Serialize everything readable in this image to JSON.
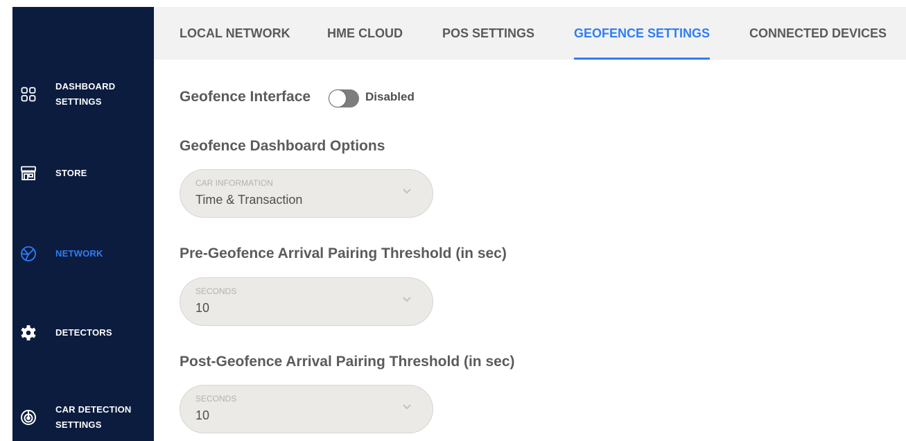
{
  "sidebar": {
    "items": [
      {
        "icon": "dashboard-grid-icon",
        "label": "DASHBOARD\nSETTINGS",
        "active": false
      },
      {
        "icon": "store-icon",
        "label": "STORE",
        "active": false
      },
      {
        "icon": "network-icon",
        "label": "NETWORK",
        "active": true
      },
      {
        "icon": "gear-icon",
        "label": "DETECTORS",
        "active": false
      },
      {
        "icon": "car-detection-icon",
        "label": "CAR DETECTION\nSETTINGS",
        "active": false
      }
    ]
  },
  "tabs": [
    {
      "label": "LOCAL NETWORK",
      "active": false
    },
    {
      "label": "HME CLOUD",
      "active": false
    },
    {
      "label": "POS SETTINGS",
      "active": false
    },
    {
      "label": "GEOFENCE SETTINGS",
      "active": true
    },
    {
      "label": "CONNECTED DEVICES",
      "active": false
    }
  ],
  "geofence": {
    "interface_label": "Geofence Interface",
    "toggle_state": "Disabled",
    "dashboard_options_title": "Geofence Dashboard Options",
    "car_info": {
      "label": "CAR INFORMATION",
      "value": "Time & Transaction"
    },
    "pre_title": "Pre-Geofence Arrival Pairing Threshold (in sec)",
    "pre_select": {
      "label": "SECONDS",
      "value": "10"
    },
    "post_title": "Post-Geofence Arrival Pairing Threshold (in sec)",
    "post_select": {
      "label": "SECONDS",
      "value": "10"
    }
  },
  "colors": {
    "sidebar_bg": "#0b1c3f",
    "accent": "#2f7df6",
    "select_bg": "#eceae6"
  }
}
